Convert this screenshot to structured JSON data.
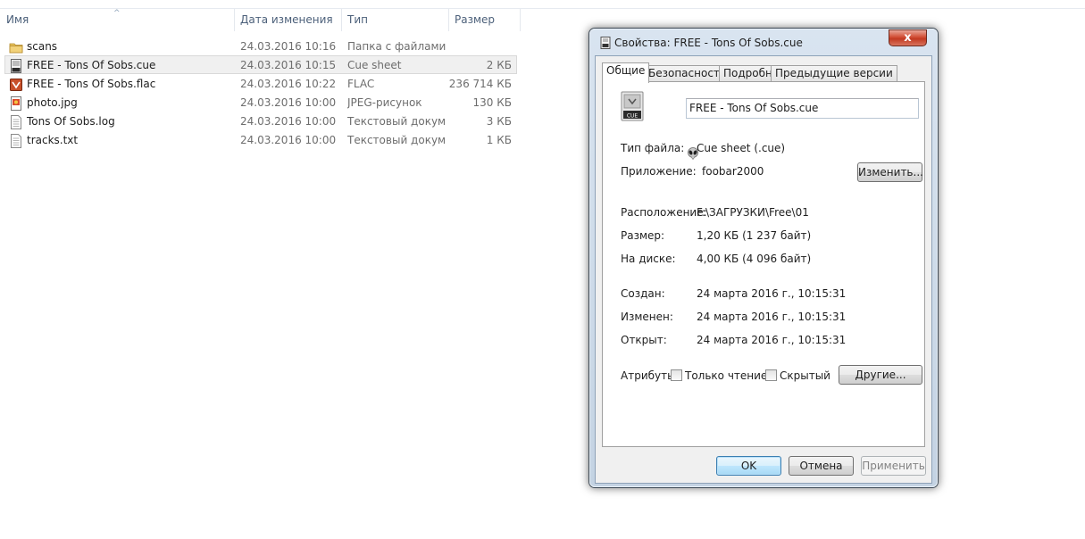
{
  "explorer": {
    "columns": {
      "name": "Имя",
      "date": "Дата изменения",
      "type": "Тип",
      "size": "Размер"
    },
    "files": [
      {
        "name": "scans",
        "date": "24.03.2016 10:16",
        "type": "Папка с файлами",
        "size": "",
        "icon": "folder-icon"
      },
      {
        "name": "FREE - Tons Of Sobs.cue",
        "date": "24.03.2016 10:15",
        "type": "Cue sheet",
        "size": "2 КБ",
        "icon": "cue-file-icon",
        "selected": true
      },
      {
        "name": "FREE - Tons Of Sobs.flac",
        "date": "24.03.2016 10:22",
        "type": "FLAC",
        "size": "236 714 КБ",
        "icon": "flac-file-icon"
      },
      {
        "name": "photo.jpg",
        "date": "24.03.2016 10:00",
        "type": "JPEG-рисунок",
        "size": "130 КБ",
        "icon": "image-file-icon"
      },
      {
        "name": "Tons Of Sobs.log",
        "date": "24.03.2016 10:00",
        "type": "Текстовый докум...",
        "size": "3 КБ",
        "icon": "text-file-icon"
      },
      {
        "name": "tracks.txt",
        "date": "24.03.2016 10:00",
        "type": "Текстовый докум...",
        "size": "1 КБ",
        "icon": "text-file-icon"
      }
    ]
  },
  "dialog": {
    "title": "Свойства: FREE - Tons Of Sobs.cue",
    "close_label": "x",
    "tabs": [
      "Общие",
      "Безопасность",
      "Подробно",
      "Предыдущие версии"
    ],
    "filename": "FREE - Tons Of Sobs.cue",
    "file_type_label": "Тип файла:",
    "file_type_value": "Cue sheet (.cue)",
    "app_label": "Приложение:",
    "app_value": "foobar2000",
    "change_button": "Изменить...",
    "location_label": "Расположение:",
    "location_value": "F:\\ЗАГРУЗКИ\\Free\\01",
    "size_label": "Размер:",
    "size_value": "1,20 КБ (1 237 байт)",
    "disk_label": "На диске:",
    "disk_value": "4,00 КБ (4 096 байт)",
    "created_label": "Создан:",
    "created_value": "24 марта 2016 г., 10:15:31",
    "modified_label": "Изменен:",
    "modified_value": "24 марта 2016 г., 10:15:31",
    "opened_label": "Открыт:",
    "opened_value": "24 марта 2016 г., 10:15:31",
    "attributes_label": "Атрибуты:",
    "readonly_label": "Только чтение",
    "hidden_label": "Скрытый",
    "other_button": "Другие...",
    "ok_button": "OK",
    "cancel_button": "Отмена",
    "apply_button": "Применить"
  }
}
